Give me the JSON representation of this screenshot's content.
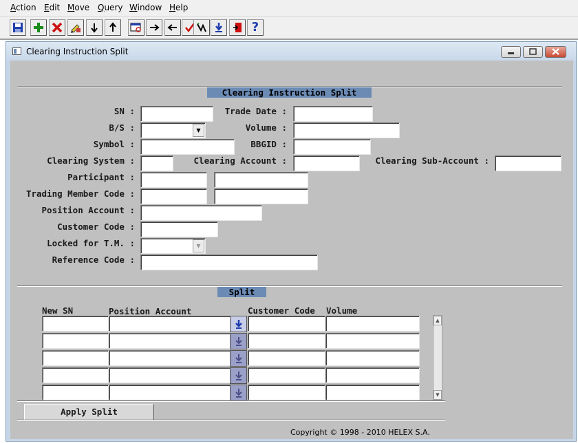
{
  "menu": [
    "Action",
    "Edit",
    "Move",
    "Query",
    "Window",
    "Help"
  ],
  "toolbar": {
    "icons": [
      "save-icon",
      "add-icon",
      "delete-icon",
      "edit-icon",
      "move-down-icon",
      "move-up-icon",
      "query-icon",
      "next-icon",
      "previous-icon",
      "check-icon",
      "execute-icon",
      "download-icon",
      "exit-icon",
      "help-icon"
    ],
    "help_glyph": "?"
  },
  "window": {
    "title": "Clearing Instruction Split"
  },
  "form": {
    "section_title": "Clearing Instruction Split",
    "labels": {
      "sn": "SN :",
      "trade_date": "Trade Date :",
      "bs": "B/S :",
      "volume": "Volume :",
      "symbol": "Symbol :",
      "bbgid": "BBGID :",
      "clearing_system": "Clearing System :",
      "clearing_account": "Clearing Account :",
      "clearing_sub_account": "Clearing Sub-Account :",
      "participant": "Participant :",
      "trading_member_code": "Trading Member Code :",
      "position_account": "Position Account :",
      "customer_code": "Customer Code :",
      "locked_for_tm": "Locked for T.M. :",
      "reference_code": "Reference Code :"
    }
  },
  "split": {
    "section_title": "Split",
    "headers": {
      "new_sn": "New SN",
      "position_account": "Position Account",
      "customer_code": "Customer Code",
      "volume": "Volume"
    },
    "rows": 5,
    "apply_label": "Apply Split"
  },
  "copyright": "Copyright © 1998 - 2010 HELEX S.A.",
  "colors": {
    "section_title_bg": "#6b8bb5",
    "form_bg": "#c0c0c0",
    "lookup_button": "#9aa0c8"
  }
}
